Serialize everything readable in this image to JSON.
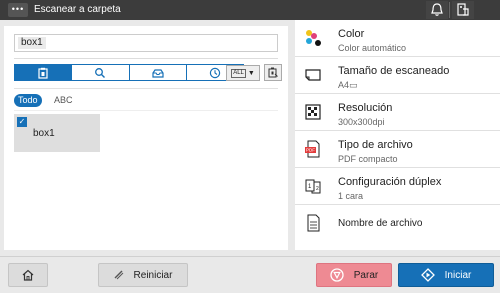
{
  "window": {
    "title": "Escanear a carpeta"
  },
  "search": {
    "value": "box1"
  },
  "filters": {
    "all_label": "Todo",
    "abc_label": "ABC",
    "dropdown_label": "ALL"
  },
  "boxes": [
    {
      "label": "box1",
      "checked": true
    }
  ],
  "settings": [
    {
      "title": "Color",
      "value": "Color automático",
      "icon": "color-icon"
    },
    {
      "title": "Tamaño de escaneado",
      "value": "A4▭",
      "icon": "paper-size-icon"
    },
    {
      "title": "Resolución",
      "value": "300x300dpi",
      "icon": "resolution-icon"
    },
    {
      "title": "Tipo de archivo",
      "value": "PDF compacto",
      "icon": "pdf-icon"
    },
    {
      "title": "Configuración dúplex",
      "value": "1 cara",
      "icon": "duplex-icon"
    },
    {
      "title": "Nombre de archivo",
      "value": "",
      "icon": "document-icon"
    }
  ],
  "footer": {
    "reset_label": "Reiniciar",
    "stop_label": "Parar",
    "start_label": "Iniciar"
  },
  "colors": {
    "accent": "#1670b7",
    "stop": "#ee8a93",
    "titlebar": "#3c3c3c"
  }
}
